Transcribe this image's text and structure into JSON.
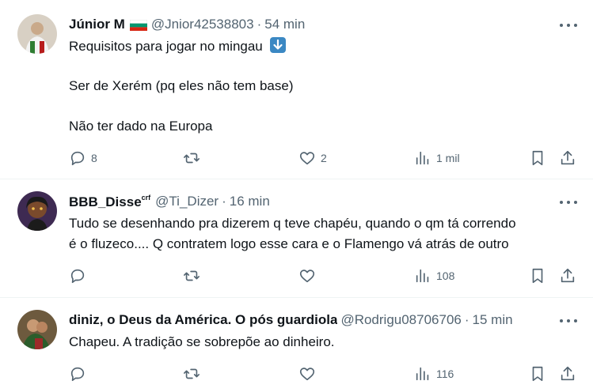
{
  "tweets": [
    {
      "name": "Júnior M",
      "handle": "@Jnior42538803",
      "time": "54 min",
      "lines": [
        "Requisitos para jogar no mingau",
        "Ser de Xerém (pq eles não tem base)",
        "Não ter dado na Europa"
      ],
      "replies": "8",
      "retweets": "",
      "likes": "2",
      "views": "1 mil",
      "avatar_colors": [
        "#d8d0c4",
        "#2e7d32",
        "#b71c1c"
      ]
    },
    {
      "name": "BBB_Disse",
      "name_sup": "crf",
      "handle": "@Ti_Dizer",
      "time": "16 min",
      "lines": [
        "Tudo se desenhando pra dizerem q teve chapéu, quando o qm tá correndo",
        "é o fluzeco.... Q  contratem logo esse cara e o Flamengo vá atrás de outro"
      ],
      "replies": "",
      "retweets": "",
      "likes": "",
      "views": "108",
      "avatar_colors": [
        "#3e2a52",
        "#7a4a2c",
        "#f2c14e"
      ]
    },
    {
      "name": "diniz, o Deus da América. O pós guardiola",
      "handle": "@Rodrigu08706706",
      "time": "15 min",
      "lines": [
        "Chapeu. A tradição se sobrepõe ao dinheiro."
      ],
      "replies": "",
      "retweets": "",
      "likes": "",
      "views": "116",
      "avatar_colors": [
        "#6d5a3e",
        "#2b5d2b",
        "#9c2a2a"
      ]
    }
  ],
  "separator": "·",
  "icons": [
    "reply-icon",
    "retweet-icon",
    "like-icon",
    "views-icon",
    "bookmark-icon",
    "share-icon",
    "more-icon",
    "bulgaria-flag-icon",
    "down-arrow-emoji"
  ],
  "colors": {
    "text": "#0f1419",
    "secondary": "#536471",
    "border": "#eff3f4"
  }
}
